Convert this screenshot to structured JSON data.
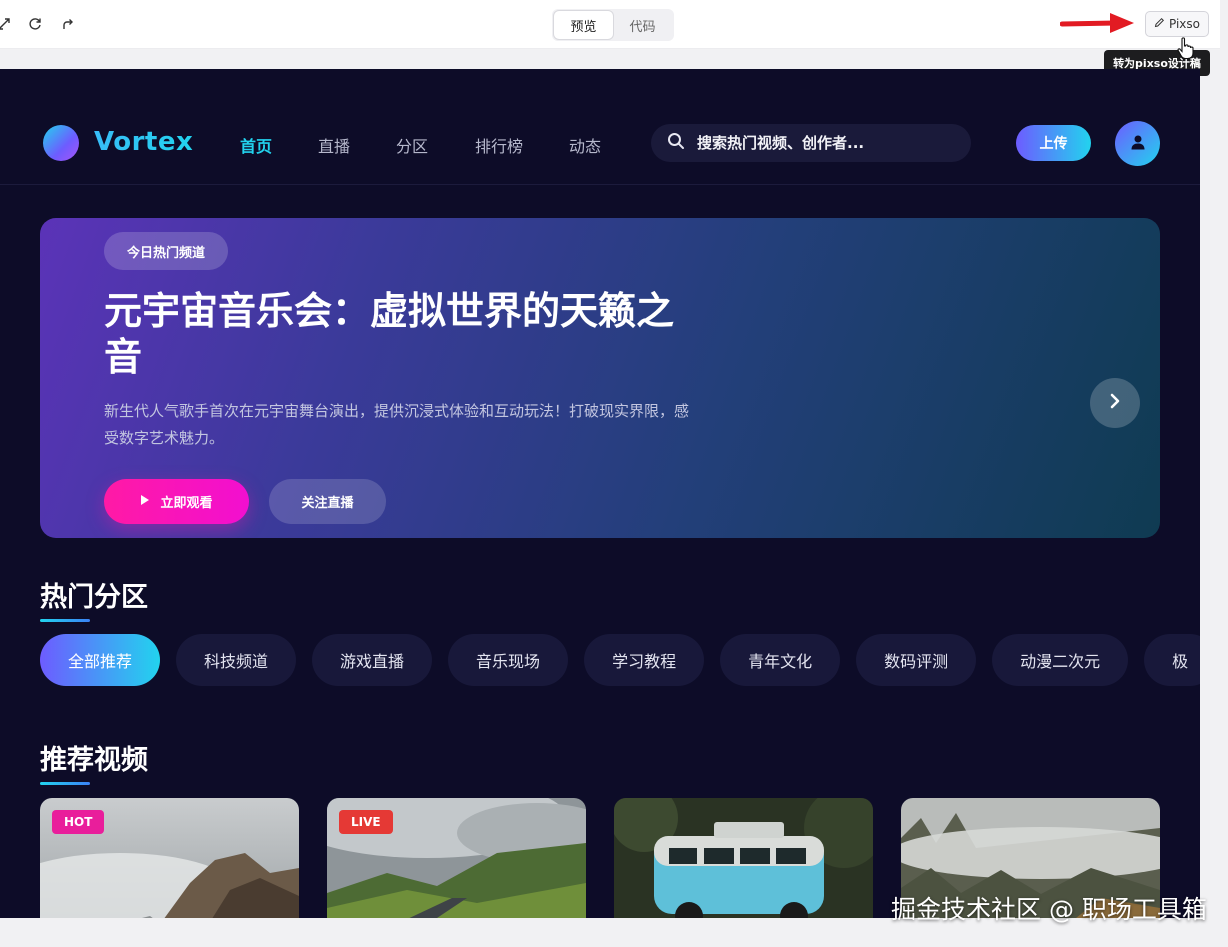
{
  "editor": {
    "tabs": [
      {
        "label": "预览",
        "active": true
      },
      {
        "label": "代码",
        "active": false
      }
    ],
    "pixso_label": "Pixso",
    "tooltip": "转为pixso设计稿"
  },
  "brand": {
    "name": "Vortex"
  },
  "nav": {
    "links": [
      {
        "label": "首页",
        "active": true
      },
      {
        "label": "直播"
      },
      {
        "label": "分区"
      },
      {
        "label": "排行榜"
      },
      {
        "label": "动态"
      }
    ],
    "search_placeholder": "搜索热门视频、创作者...",
    "upload_label": "上传"
  },
  "hero": {
    "badge": "今日热门频道",
    "title": "元宇宙音乐会：虚拟世界的天籁之音",
    "description": "新生代人气歌手首次在元宇宙舞台演出，提供沉浸式体验和互动玩法！打破现实界限，感受数字艺术魅力。",
    "watch_label": "立即观看",
    "follow_label": "关注直播"
  },
  "categories": {
    "title": "热门分区",
    "items": [
      "全部推荐",
      "科技频道",
      "游戏直播",
      "音乐现场",
      "学习教程",
      "青年文化",
      "数码评测",
      "动漫二次元",
      "极"
    ]
  },
  "videos": {
    "title": "推荐视频",
    "cards": [
      {
        "tag": "HOT",
        "tag_color": "#e91e9b"
      },
      {
        "tag": "LIVE",
        "tag_color": "#e53935"
      },
      {
        "tag": ""
      },
      {
        "tag": ""
      }
    ]
  },
  "watermark": "掘金技术社区 @ 职场工具箱",
  "colors": {
    "accent_cyan": "#22d3ee",
    "accent_purple": "#6d5cff",
    "accent_pink": "#ff1aa5",
    "background": "#0d0c28"
  }
}
